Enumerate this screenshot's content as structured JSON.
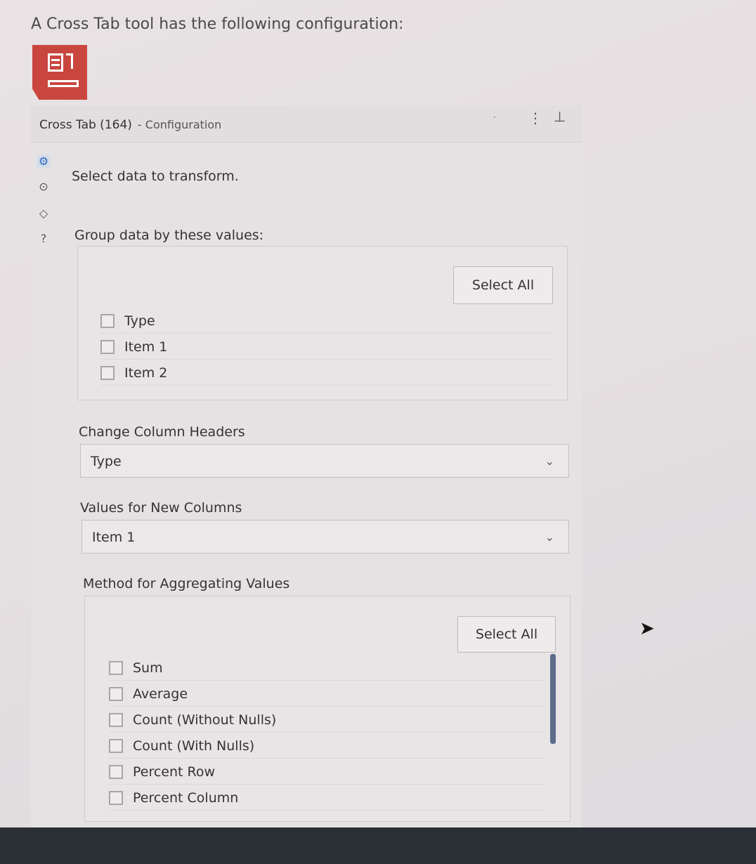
{
  "question": "A Cross Tab tool has the following configuration:",
  "tool_icon": "cross-tab-icon",
  "panel": {
    "title": "Cross Tab (164)",
    "subtitle": "- Configuration",
    "header_icons": [
      "overflow-menu-icon",
      "pin-icon"
    ],
    "side_icons": [
      "gear-icon",
      "arrow-circle-icon",
      "tag-icon",
      "help-icon"
    ],
    "intro": "Select data to transform.",
    "group_section": {
      "label": "Group data by these values:",
      "select_all": "Select All",
      "items": [
        {
          "label": "Type",
          "checked": false
        },
        {
          "label": "Item 1",
          "checked": false
        },
        {
          "label": "Item 2",
          "checked": false
        }
      ]
    },
    "column_headers": {
      "label": "Change Column Headers",
      "value": "Type"
    },
    "new_columns": {
      "label": "Values for New Columns",
      "value": "Item 1"
    },
    "aggregation": {
      "label": "Method for Aggregating Values",
      "select_all": "Select All",
      "items": [
        {
          "label": "Sum",
          "checked": false
        },
        {
          "label": "Average",
          "checked": false
        },
        {
          "label": "Count (Without Nulls)",
          "checked": false
        },
        {
          "label": "Count (With Nulls)",
          "checked": false
        },
        {
          "label": "Percent Row",
          "checked": false
        },
        {
          "label": "Percent Column",
          "checked": false
        }
      ]
    }
  }
}
